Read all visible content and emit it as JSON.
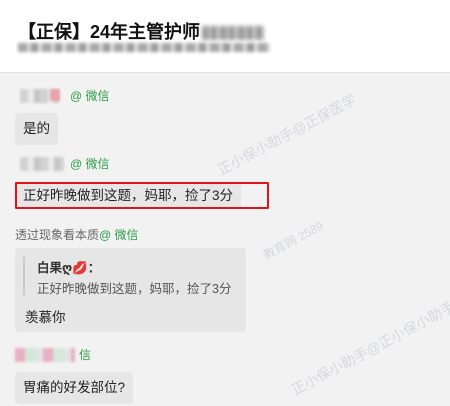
{
  "header": {
    "title": "【正保】24年主管护师"
  },
  "messages": [
    {
      "at_label": "@ 微信",
      "text": "是的"
    },
    {
      "at_label": "@ 微信",
      "text": "正好昨晚做到这题，妈耶，捡了3分"
    },
    {
      "sender": "透过现象看本质",
      "at_label": "@ 微信",
      "quote_author": "白果ღ💋：",
      "quote_text": "正好昨晚做到这题，妈耶，捡了3分",
      "text": "羡慕你"
    },
    {
      "at_label": "信",
      "text": "胃痛的好发部位?"
    }
  ],
  "watermarks": [
    "正小保小助手@正保医学",
    "教育网 2589",
    "正小保小助手@正小保小助手@"
  ],
  "colors": {
    "highlight": "#e0141b",
    "channel_green": "#2e9b48",
    "bubble_bg": "#e6e6e6"
  }
}
